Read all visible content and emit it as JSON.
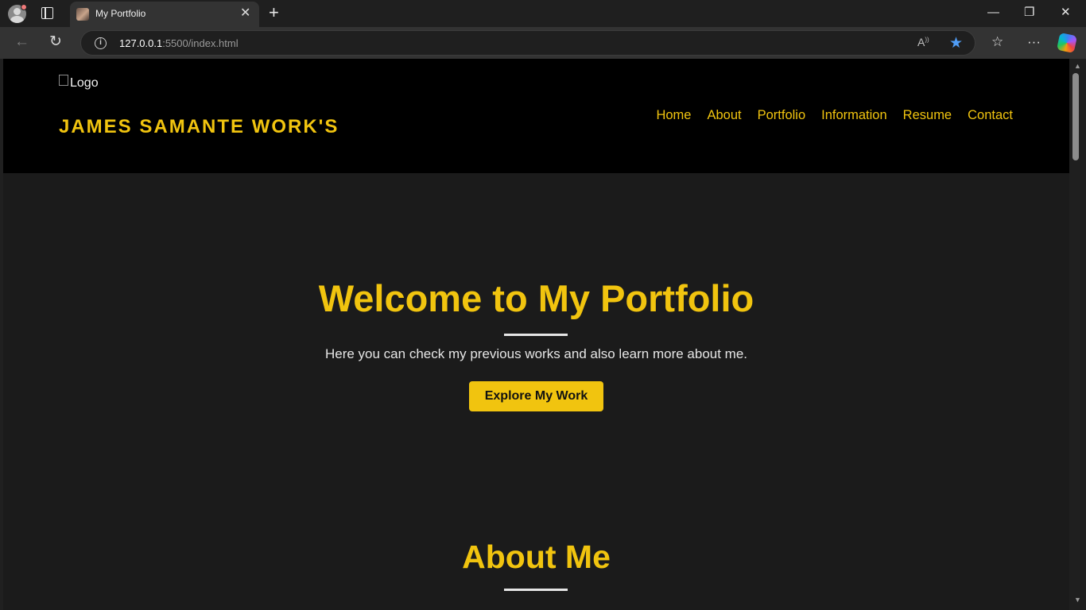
{
  "browser": {
    "tab": {
      "title": "My Portfolio"
    },
    "new_tab_glyph": "+",
    "controls": {
      "minimize": "—",
      "restore": "❐",
      "close": "✕"
    },
    "address": {
      "host": "127.0.0.1",
      "rest": ":5500/index.html"
    },
    "icons": [
      "profile-icon",
      "tabs-icon",
      "back-icon",
      "refresh-icon",
      "info-icon",
      "read-aloud-icon",
      "favorite-star-icon",
      "favorites-icon",
      "more-icon",
      "copilot-icon"
    ],
    "accent": "#4f9cf5"
  },
  "site": {
    "logo_alt": "Logo",
    "brand": "JAMES SAMANTE WORK'S",
    "nav": [
      "Home",
      "About",
      "Portfolio",
      "Information",
      "Resume",
      "Contact"
    ],
    "hero": {
      "title": "Welcome to My Portfolio",
      "subtitle": "Here you can check my previous works and also learn more about me.",
      "cta": "Explore My Work"
    },
    "about": {
      "title": "About Me"
    },
    "colors": {
      "accent": "#f1c40f",
      "header_bg": "#000000",
      "body_bg": "#1b1b1b"
    }
  }
}
